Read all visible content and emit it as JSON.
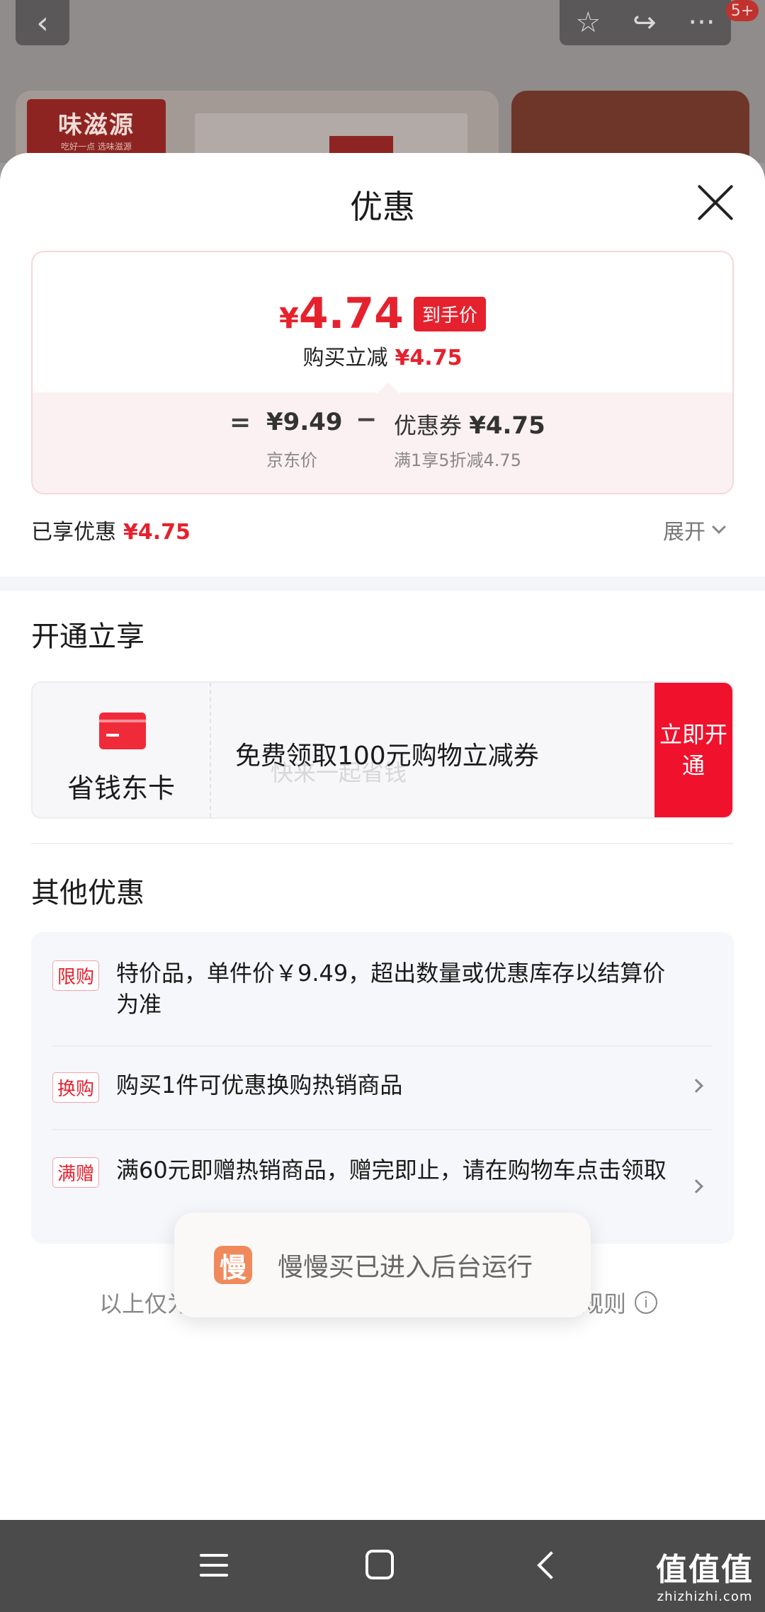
{
  "background": {
    "back_icon": "‹",
    "star_icon": "☆",
    "share_icon": "↪",
    "more_icon": "···",
    "badge": "5+",
    "logo_text": "味滋源",
    "logo_sub": "吃好一点 选味滋源"
  },
  "sheet": {
    "title": "优惠",
    "price_box": {
      "currency": "¥",
      "final_price": "4.74",
      "final_tag": "到手价",
      "instant_label": "购买立减",
      "instant_amount": "¥4.75",
      "eq": "=",
      "jd_price": "¥9.49",
      "jd_price_label": "京东价",
      "minus": "−",
      "coupon_label": "优惠券",
      "coupon_amount": "¥4.75",
      "coupon_rule": "满1享5折减4.75"
    },
    "enjoyed_label": "已享优惠",
    "enjoyed_amount": "¥4.75",
    "expand_label": "展开"
  },
  "open_section": {
    "title": "开通立享",
    "card_name": "省钱东卡",
    "offer": "免费领取100元购物立减券",
    "watermark": "快来一起省钱",
    "button": "立即开通"
  },
  "other_section": {
    "title": "其他优惠",
    "items": [
      {
        "tag": "限购",
        "text": "特价品，单件价￥9.49，超出数量或优惠库存以结算价为准"
      },
      {
        "tag": "换购",
        "text": "购买1件可优惠换购热销商品"
      },
      {
        "tag": "满赠",
        "text": "满60元即赠热销商品，赠完即止，请在购物车点击领取"
      }
    ]
  },
  "toast": {
    "icon_char": "慢",
    "text": "慢慢买已进入后台运行"
  },
  "footer": {
    "left_text": "以上仅为",
    "right_text": "规则",
    "info_icon": "i"
  },
  "brand": {
    "name": "值值值",
    "domain": "zhizhizhi.com"
  }
}
